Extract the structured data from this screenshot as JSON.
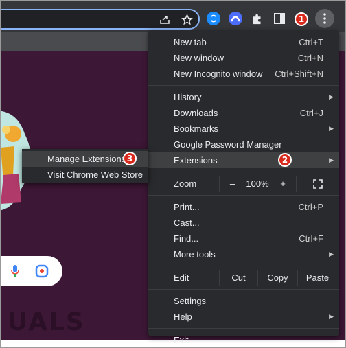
{
  "badges": {
    "one": "1",
    "two": "2",
    "three": "3"
  },
  "watermark": "UALS",
  "menu": {
    "new_tab": {
      "label": "New tab",
      "shortcut": "Ctrl+T"
    },
    "new_window": {
      "label": "New window",
      "shortcut": "Ctrl+N"
    },
    "new_incognito": {
      "label": "New Incognito window",
      "shortcut": "Ctrl+Shift+N"
    },
    "history": {
      "label": "History"
    },
    "downloads": {
      "label": "Downloads",
      "shortcut": "Ctrl+J"
    },
    "bookmarks": {
      "label": "Bookmarks"
    },
    "password_manager": {
      "label": "Google Password Manager"
    },
    "extensions": {
      "label": "Extensions"
    },
    "zoom": {
      "label": "Zoom",
      "minus": "–",
      "value": "100%",
      "plus": "+"
    },
    "print": {
      "label": "Print...",
      "shortcut": "Ctrl+P"
    },
    "cast": {
      "label": "Cast..."
    },
    "find": {
      "label": "Find...",
      "shortcut": "Ctrl+F"
    },
    "more_tools": {
      "label": "More tools"
    },
    "edit": {
      "label": "Edit",
      "cut": "Cut",
      "copy": "Copy",
      "paste": "Paste"
    },
    "settings": {
      "label": "Settings"
    },
    "help": {
      "label": "Help"
    },
    "exit": {
      "label": "Exit"
    }
  },
  "submenu": {
    "manage": "Manage Extensions",
    "store": "Visit Chrome Web Store"
  },
  "colors": {
    "badge": "#d9291c",
    "page_bg": "#3d1736",
    "menu_bg": "#292a2d"
  }
}
